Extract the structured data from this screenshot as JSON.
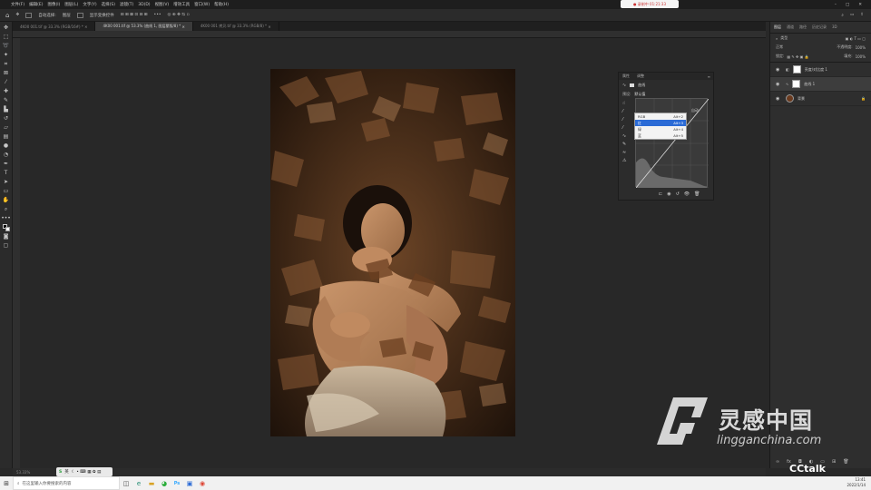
{
  "menubar": {
    "items": [
      "文件(F)",
      "编辑(E)",
      "图像(I)",
      "图层(L)",
      "文字(Y)",
      "选择(S)",
      "滤镜(T)",
      "3D(D)",
      "视图(V)",
      "增效工具",
      "窗口(W)",
      "帮助(H)"
    ]
  },
  "notification": {
    "text": "● 录制中 01:21:33"
  },
  "options": {
    "home_icon": "home-icon",
    "auto_select": "自动选择:",
    "layer_select": "图层",
    "show_transform": "显示变换控件"
  },
  "tabs": [
    {
      "label": "4K00 001.tif @ 33.3% (RGB/16#) *",
      "active": false
    },
    {
      "label": "4K00 001.tif @ 53.3% (曲线 1, 图层蒙版/8) *",
      "active": true
    },
    {
      "label": "4K00 001 拷贝.tif @ 33.3% (RGB/8) *",
      "active": false
    }
  ],
  "tools": [
    "move",
    "marquee",
    "lasso",
    "wand",
    "crop",
    "frame",
    "eyedropper",
    "heal",
    "brush",
    "stamp",
    "history",
    "eraser",
    "gradient",
    "blur",
    "dodge",
    "pen",
    "type",
    "path",
    "shape",
    "hand",
    "zoom",
    "more",
    "colors",
    "quickmask",
    "screen"
  ],
  "layers_panel": {
    "tabs": [
      "图层",
      "通道",
      "路径",
      "历史记录",
      "3D"
    ],
    "kind_label": "类型",
    "blend_mode": "正常",
    "opacity_label": "不透明度:",
    "opacity_value": "100%",
    "lock_label": "锁定:",
    "fill_label": "填充:",
    "fill_value": "100%",
    "layers": [
      {
        "name": "亮度/对比度 1",
        "selected": false,
        "thumb": "adjust"
      },
      {
        "name": "曲线 1",
        "selected": true,
        "thumb": "curves"
      },
      {
        "name": "背景",
        "selected": false,
        "thumb": "photo"
      }
    ]
  },
  "properties_panel": {
    "tabs": [
      "属性",
      "调整"
    ],
    "title": "曲线",
    "preset_label": "预设:",
    "preset_value": "默认值",
    "channel_label": "自动",
    "dropdown": [
      {
        "label": "RGB",
        "shortcut": "Alt+2",
        "highlight": false
      },
      {
        "label": "红",
        "shortcut": "Alt+3",
        "highlight": true
      },
      {
        "label": "绿",
        "shortcut": "Alt+4",
        "highlight": false
      },
      {
        "label": "蓝",
        "shortcut": "Alt+5",
        "highlight": false
      }
    ]
  },
  "status": {
    "zoom": "53.33%",
    "doc": "文档:47.5M/95.0M"
  },
  "floatbar": {
    "label": "英"
  },
  "taskbar": {
    "search_placeholder": "在这里输入你要搜索的内容",
    "time": "13:41",
    "date": "2022/1/14"
  },
  "watermark": {
    "brand": "灵感中国",
    "url": "lingganchina.com",
    "cctalk": "CCtalk"
  },
  "colors": {
    "accent": "#2b6bd6",
    "panel": "#2e2e2e",
    "canvas": "#282828"
  }
}
